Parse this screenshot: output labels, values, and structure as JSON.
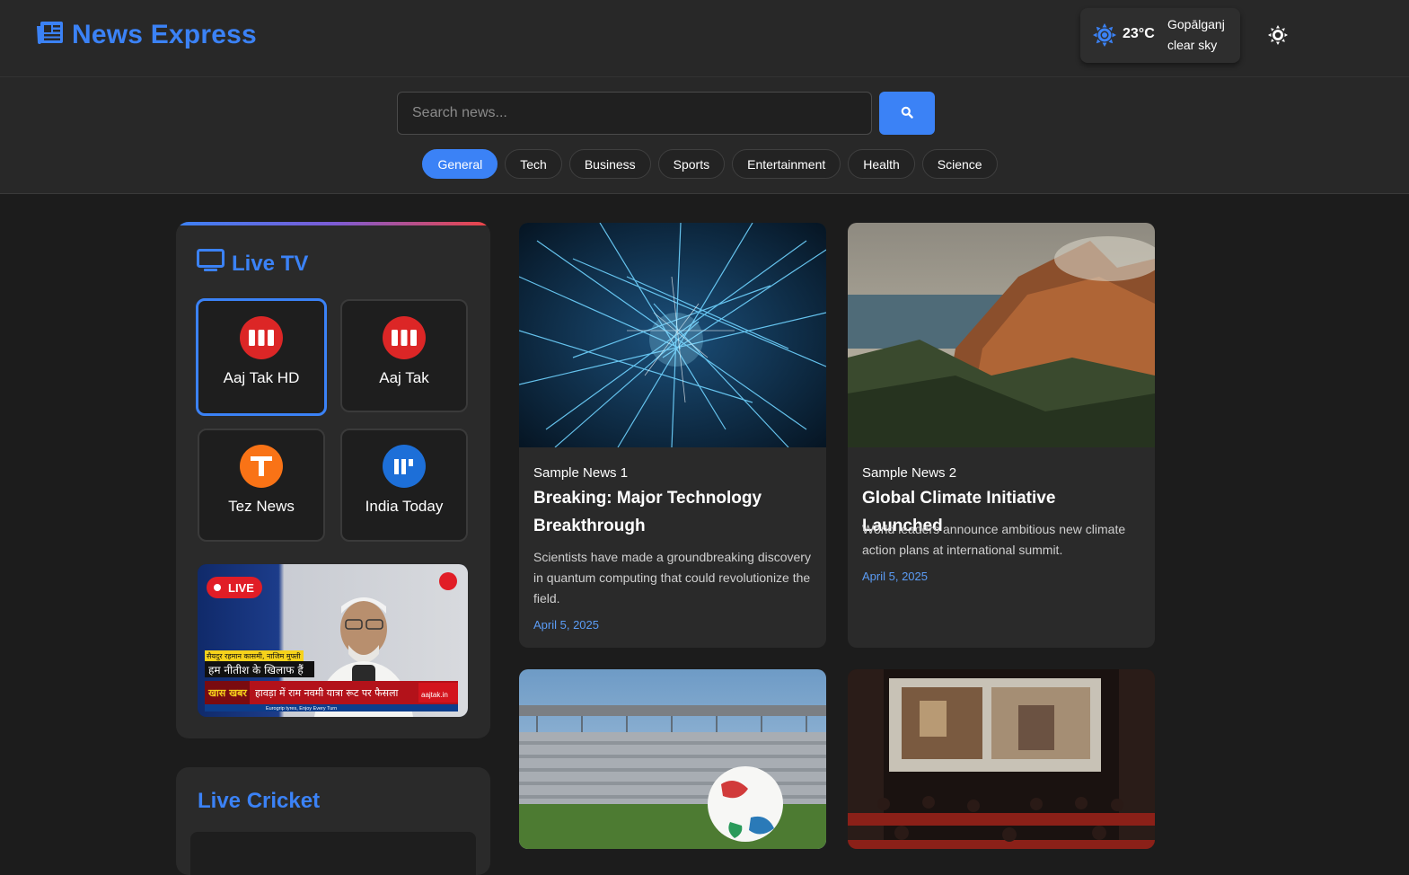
{
  "header": {
    "logo_text": "News Express"
  },
  "weather": {
    "temperature": "23°C",
    "city": "Gopālganj",
    "description": "clear sky"
  },
  "search": {
    "placeholder": "Search news..."
  },
  "categories": [
    "General",
    "Tech",
    "Business",
    "Sports",
    "Entertainment",
    "Health",
    "Science"
  ],
  "active_category": "General",
  "live_tv": {
    "title": "Live TV",
    "channels": [
      {
        "name": "Aaj Tak HD",
        "logo_color": "#dc2626",
        "icon": "bars-logo-icon",
        "active": true
      },
      {
        "name": "Aaj Tak",
        "logo_color": "#dc2626",
        "icon": "bars-logo-icon",
        "active": false
      },
      {
        "name": "Tez News",
        "logo_color": "#f97316",
        "icon": "t-logo-icon",
        "active": false
      },
      {
        "name": "India Today",
        "logo_color": "#1d6fd8",
        "icon": "it-logo-icon",
        "active": false
      }
    ],
    "player": {
      "live_badge": "LIVE",
      "ticker_top": "सैयदुर रहमान कासमी, नाजिम मुफ्ती",
      "ticker_main": "हम नीतीश के खिलाफ हैं",
      "ticker_tag": "खास खबर",
      "ticker_headline": "हावड़ा में राम नवमी यात्रा रूट पर फैसला",
      "ticker_site": "aajtak.in",
      "ticker_sponsor": "Eurogrip tyres, Enjoy Every Turn"
    }
  },
  "live_cricket": {
    "title": "Live Cricket"
  },
  "news": [
    {
      "source": "Sample News 1",
      "title": "Breaking: Major Technology Breakthrough",
      "description": "Scientists have made a groundbreaking discovery in quantum computing that could revolutionize the field.",
      "date": "April 5, 2025",
      "image": "network-lines-image"
    },
    {
      "source": "Sample News 2",
      "title": "Global Climate Initiative Launched",
      "description": "World leaders announce ambitious new climate action plans at international summit.",
      "date": "April 5, 2025",
      "image": "mountain-coast-image"
    },
    {
      "image": "stadium-football-image"
    },
    {
      "image": "cinema-screen-image"
    }
  ],
  "colors": {
    "accent": "#3b82f6",
    "background": "#1c1c1c",
    "header": "#282828",
    "card": "#2a2a2a",
    "date": "#5b9cf5"
  }
}
